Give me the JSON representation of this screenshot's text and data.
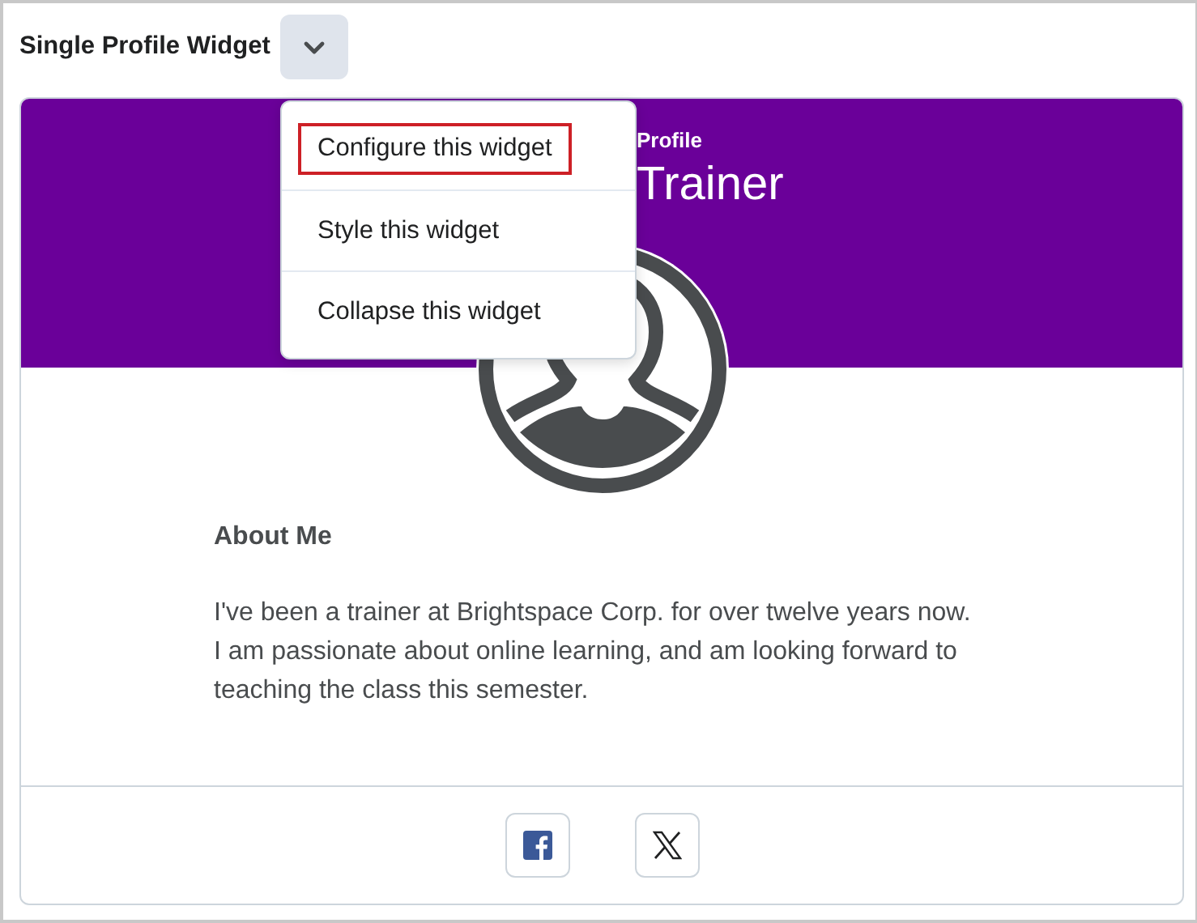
{
  "widget": {
    "title": "Single Profile Widget",
    "menu_open": true
  },
  "menu": {
    "items": [
      {
        "label": "Configure this widget",
        "selected": true
      },
      {
        "label": "Style this widget",
        "selected": false
      },
      {
        "label": "Collapse this widget",
        "selected": false
      }
    ]
  },
  "banner": {
    "subtitle": "Profile",
    "name": "Trainer"
  },
  "about": {
    "heading": "About Me",
    "lines": [
      "I've been a trainer at Brightspace Corp. for over twelve years now.",
      "I am passionate about online learning, and am looking forward to",
      "teaching the class this semester."
    ]
  },
  "social": [
    {
      "kind": "facebook"
    },
    {
      "kind": "x"
    }
  ]
}
